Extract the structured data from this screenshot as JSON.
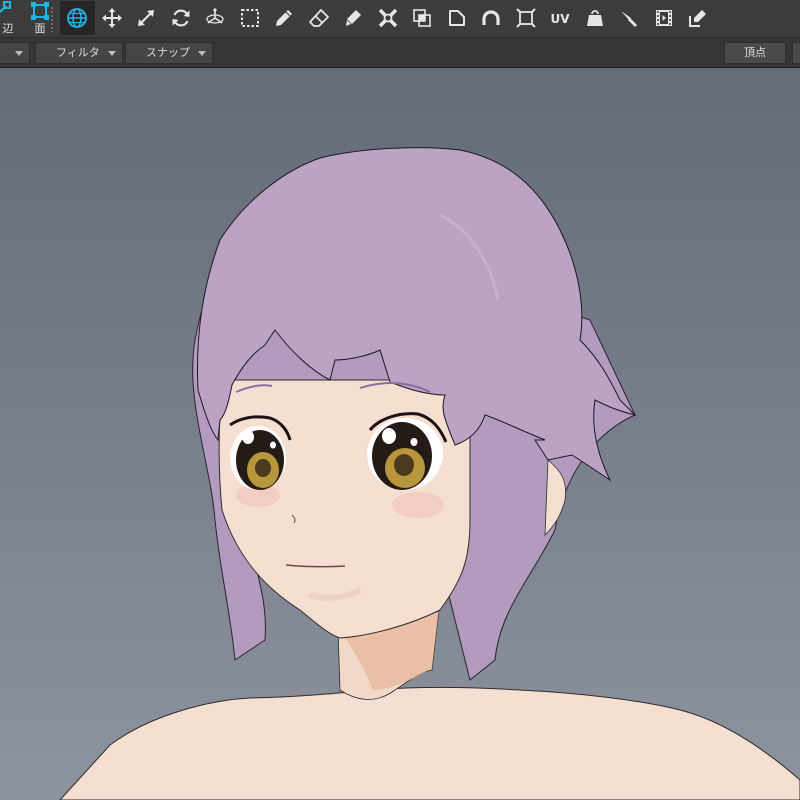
{
  "selection_modes": {
    "edge_label": "辺",
    "face_label": "面"
  },
  "tools": [
    {
      "icon": "globe-icon",
      "active": true
    },
    {
      "icon": "move-icon"
    },
    {
      "icon": "scale-icon"
    },
    {
      "icon": "rotate-icon"
    },
    {
      "icon": "gizmo-icon"
    },
    {
      "icon": "rect-select-icon"
    },
    {
      "icon": "pencil-icon"
    },
    {
      "icon": "eraser-icon"
    },
    {
      "icon": "brush-icon"
    },
    {
      "icon": "vertex-cross-icon"
    },
    {
      "icon": "overlap-icon"
    },
    {
      "icon": "bevel-icon"
    },
    {
      "icon": "arc-icon"
    },
    {
      "icon": "frame-icon"
    },
    {
      "icon": "uv-icon",
      "text": "UV"
    },
    {
      "icon": "weight-icon"
    },
    {
      "icon": "knife-icon"
    },
    {
      "icon": "film-icon"
    },
    {
      "icon": "edit-icon"
    }
  ],
  "bar2": {
    "filter_label": "フィルタ",
    "snap_label": "スナップ",
    "vertex_button": "頂点"
  },
  "colors": {
    "accent": "#1fb6ea",
    "hair": "#bba3c6",
    "skin": "#f5dfd0",
    "iris": "#b8963b"
  }
}
